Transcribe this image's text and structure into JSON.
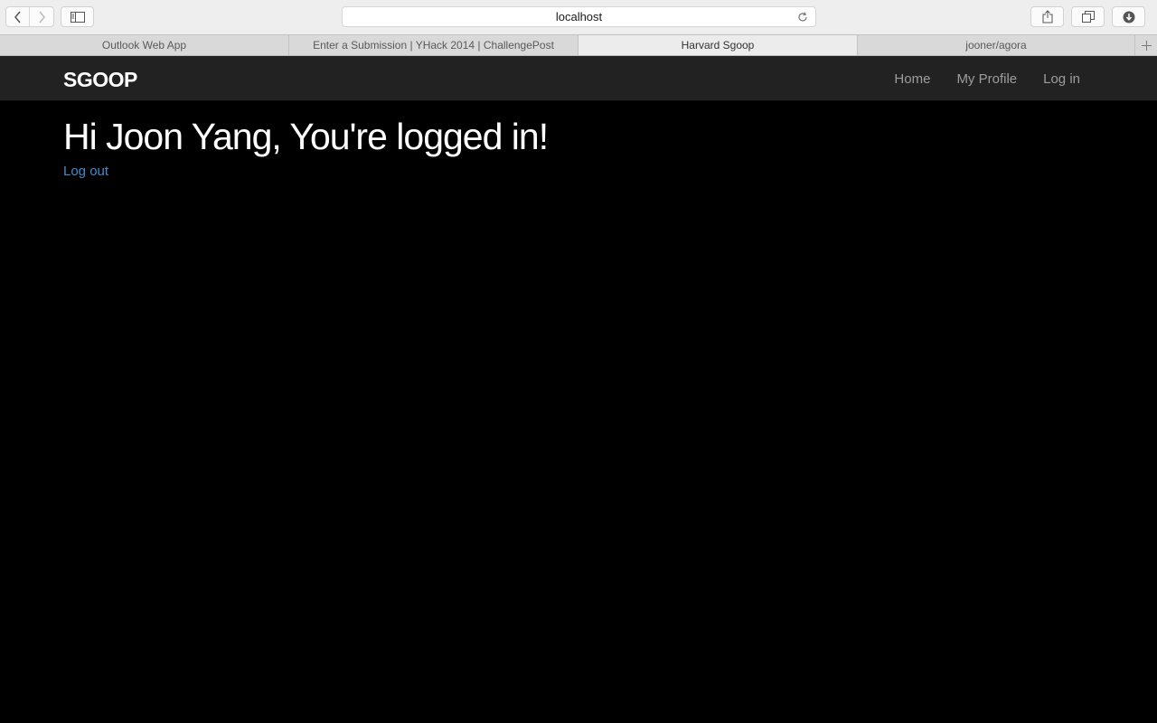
{
  "browser": {
    "address": "localhost",
    "tabs": [
      {
        "label": "Outlook Web App",
        "active": false
      },
      {
        "label": "Enter a Submission | YHack 2014 | ChallengePost",
        "active": false
      },
      {
        "label": "Harvard Sgoop",
        "active": true
      },
      {
        "label": "jooner/agora",
        "active": false
      }
    ],
    "icons": {
      "back": "chevron-left-icon",
      "forward": "chevron-right-icon",
      "sidebar": "sidebar-icon",
      "reload": "reload-icon",
      "share": "share-icon",
      "tabs": "tabs-overview-icon",
      "downloads": "download-icon",
      "new_tab": "plus-icon"
    }
  },
  "navbar": {
    "brand": "SGOOP",
    "links": [
      "Home",
      "My Profile",
      "Log in"
    ]
  },
  "main": {
    "headline": "Hi Joon Yang, You're logged in!",
    "logout": "Log out"
  },
  "colors": {
    "navbar_bg": "#222222",
    "page_bg": "#000000",
    "link": "#428bca",
    "nav_link": "#9d9d9d"
  }
}
